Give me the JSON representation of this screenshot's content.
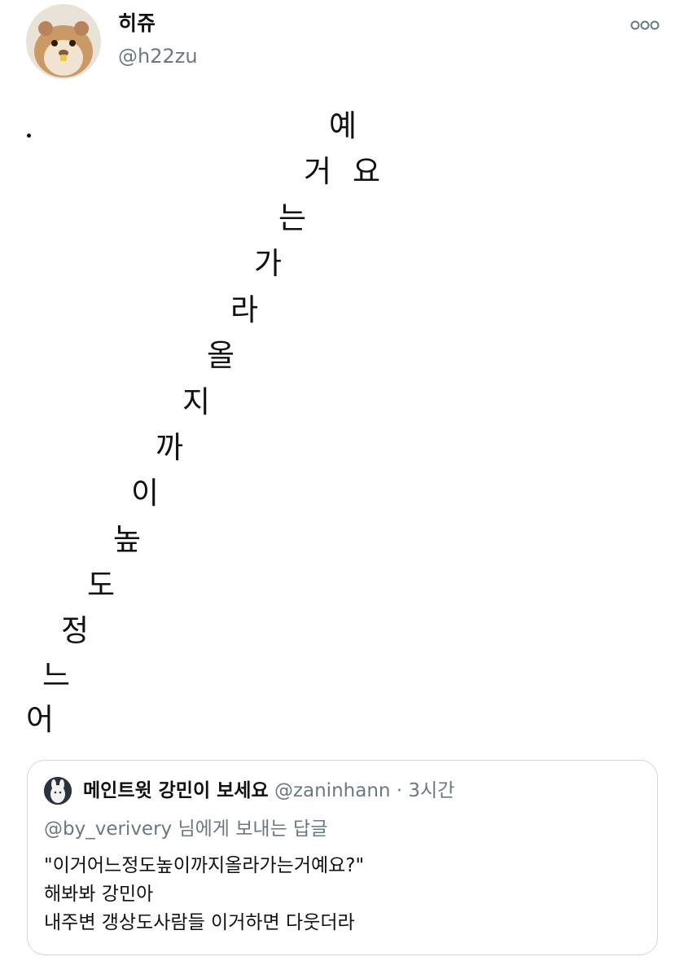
{
  "author": {
    "display_name": "히쥬",
    "handle": "@h22zu",
    "avatar_icon": "hamster-avatar"
  },
  "more_icon": "more-options-icon",
  "tweet": {
    "lead_mark": ".",
    "glyphs": [
      "예",
      "거",
      "요",
      "는",
      "가",
      "라",
      "올",
      "지",
      "까",
      "이",
      "높",
      "도",
      "정",
      "느",
      "어"
    ]
  },
  "quoted_tweet": {
    "display_name": "메인트윗 강민이 보세요",
    "handle": "@zaninhann",
    "separator": "·",
    "time": "3시간",
    "reply_mention": "@by_verivery",
    "reply_suffix": " 님에게 보내는 답글",
    "lines": [
      "\"이거어느정도높이까지올라가는거예요?\"",
      "해봐봐 강민아",
      "내주변 갱상도사람들 이거하면 다웃더라"
    ]
  },
  "colors": {
    "text": "#111111",
    "muted": "#6b7883",
    "border": "#cfd9de"
  }
}
